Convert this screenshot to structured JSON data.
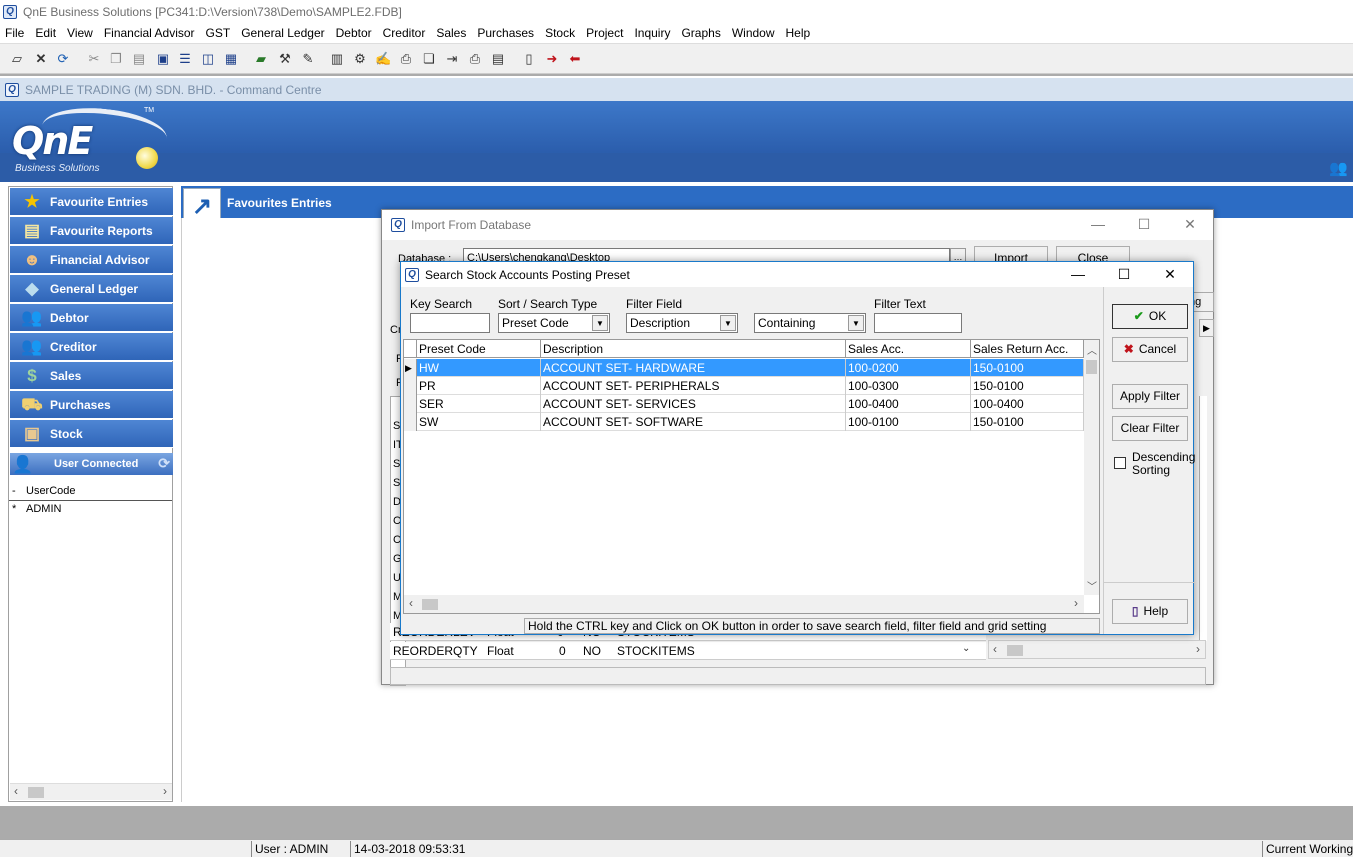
{
  "app": {
    "title": "QnE Business Solutions [PC341:D:\\Version\\738\\Demo\\SAMPLE2.FDB]",
    "icon": "qne-app-icon"
  },
  "menu": [
    "File",
    "Edit",
    "View",
    "Financial Advisor",
    "GST",
    "General Ledger",
    "Debtor",
    "Creditor",
    "Sales",
    "Purchases",
    "Stock",
    "Project",
    "Inquiry",
    "Graphs",
    "Window",
    "Help"
  ],
  "command_centre": {
    "title": "SAMPLE TRADING (M) SDN. BHD. - Command Centre",
    "logo_text": "QnE",
    "logo_sub": "Business Solutions",
    "logo_tm": "TM"
  },
  "nav": {
    "items": [
      {
        "label": "Favourite Entries",
        "icon": "star-icon"
      },
      {
        "label": "Favourite Reports",
        "icon": "report-star-icon"
      },
      {
        "label": "Financial Advisor",
        "icon": "advisor-icon"
      },
      {
        "label": "General Ledger",
        "icon": "ledger-icon"
      },
      {
        "label": "Debtor",
        "icon": "people-icon"
      },
      {
        "label": "Creditor",
        "icon": "people-icon"
      },
      {
        "label": "Sales",
        "icon": "sales-icon"
      },
      {
        "label": "Purchases",
        "icon": "truck-icon"
      },
      {
        "label": "Stock",
        "icon": "box-icon"
      }
    ],
    "user_connected": {
      "title": "User Connected",
      "col_marker": "-",
      "col_header": "UserCode",
      "row_marker": "*",
      "row_value": "ADMIN"
    }
  },
  "favourites": {
    "title": "Favourites Entries"
  },
  "import_dialog": {
    "title": "Import From Database",
    "database_label": "Database :",
    "database_value": "C:\\Users\\chengkang\\Desktop",
    "import_label": "Import",
    "close_label": "Close",
    "side_tab": "ng",
    "cr_label": "Cr",
    "f_labels": [
      "F",
      "F"
    ],
    "left_letters": [
      "S",
      "IT",
      "S",
      "S",
      "D",
      "C",
      "C",
      "G",
      "U",
      "M",
      "M"
    ],
    "rows": [
      {
        "name": "REORDERLEV",
        "type": "Float",
        "size": "0",
        "null": "NO",
        "table": "STOCKITEMS"
      },
      {
        "name": "REORDERQTY",
        "type": "Float",
        "size": "0",
        "null": "NO",
        "table": "STOCKITEMS"
      }
    ]
  },
  "search_dialog": {
    "title": "Search Stock Accounts Posting Preset",
    "key_search_label": "Key Search",
    "key_search_value": "",
    "sort_label": "Sort / Search Type",
    "sort_value": "Preset Code",
    "filter_field_label": "Filter Field",
    "filter_field_value": "Description",
    "filter_mode_value": "Containing",
    "filter_text_label": "Filter Text",
    "filter_text_value": "",
    "columns": [
      "Preset Code",
      "Description",
      "Sales Acc.",
      "Sales Return Acc."
    ],
    "rows": [
      {
        "code": "HW",
        "desc": "ACCOUNT SET- HARDWARE",
        "sales": "100-0200",
        "ret": "150-0100",
        "selected": true
      },
      {
        "code": "PR",
        "desc": "ACCOUNT SET- PERIPHERALS",
        "sales": "100-0300",
        "ret": "150-0100",
        "selected": false
      },
      {
        "code": "SER",
        "desc": "ACCOUNT SET- SERVICES",
        "sales": "100-0400",
        "ret": "100-0400",
        "selected": false
      },
      {
        "code": "SW",
        "desc": "ACCOUNT SET- SOFTWARE",
        "sales": "100-0100",
        "ret": "150-0100",
        "selected": false
      }
    ],
    "hint": "Hold the CTRL key and Click on OK button in order to save search field, filter field and grid setting",
    "ok_label": "OK",
    "cancel_label": "Cancel",
    "apply_filter_label": "Apply Filter",
    "clear_filter_label": "Clear Filter",
    "descending_label_1": "Descending",
    "descending_label_2": "Sorting",
    "help_label": "Help"
  },
  "status": {
    "user": "User : ADMIN",
    "datetime": "14-03-2018 09:53:31",
    "working": "Current Working D"
  },
  "colors": {
    "nav_blue": "#2f65b8",
    "banner_blue": "#2c5fae",
    "selection": "#3399ff",
    "ok_green": "#1a9a1a",
    "cancel_red": "#c0141c"
  }
}
